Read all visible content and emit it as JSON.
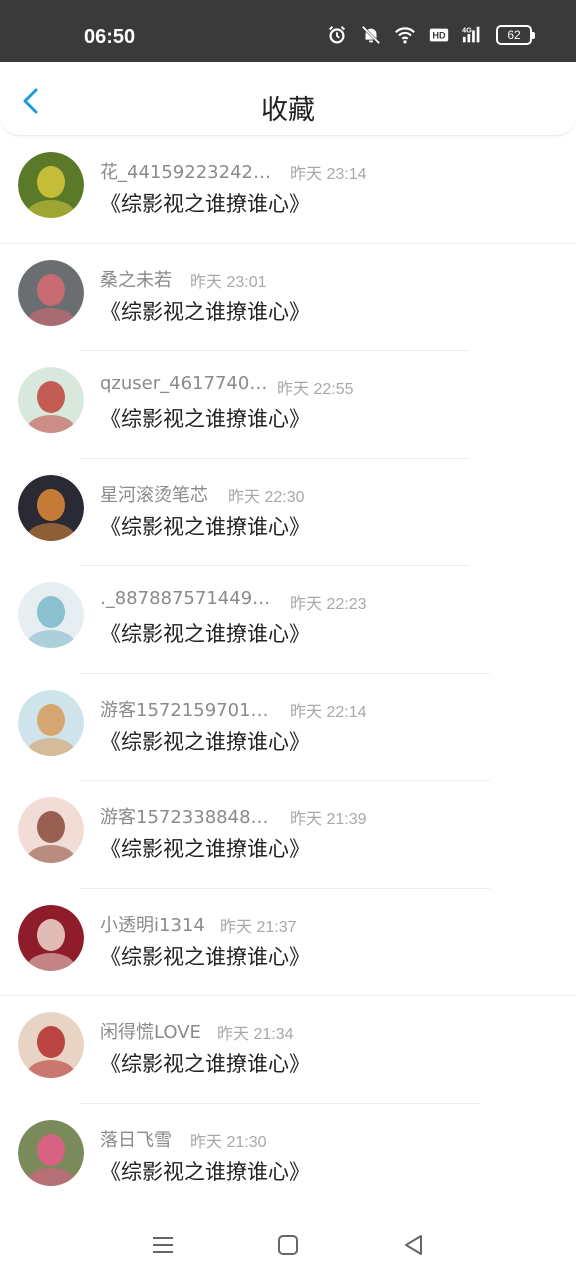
{
  "status": {
    "time": "06:50",
    "battery": "62",
    "icons": [
      "alarm-icon",
      "mute-icon",
      "wifi-icon",
      "hd-icon",
      "signal-4g-icon"
    ]
  },
  "header": {
    "title": "收藏",
    "back_icon": "chevron-left-icon"
  },
  "items": [
    {
      "name": "花_441592232424...",
      "time": "昨天 23:14",
      "content": "《综影视之谁撩谁心》",
      "avatar": {
        "bg": "#5a7a2a",
        "fg": "#d8c83a"
      }
    },
    {
      "name": "桑之未若",
      "time": "昨天 23:01",
      "content": "《综影视之谁撩谁心》",
      "avatar": {
        "bg": "#6b6e70",
        "fg": "#d86a72"
      }
    },
    {
      "name": "qzuser_461774091",
      "time": "昨天 22:55",
      "content": "《综影视之谁撩谁心》",
      "avatar": {
        "bg": "#d8e8dc",
        "fg": "#c0443c"
      }
    },
    {
      "name": "星河滚烫笔芯",
      "time": "昨天 22:30",
      "content": "《综影视之谁撩谁心》",
      "avatar": {
        "bg": "#2a2a34",
        "fg": "#e08a3a"
      }
    },
    {
      "name": "._8878875714490...",
      "time": "昨天 22:23",
      "content": "《综影视之谁撩谁心》",
      "avatar": {
        "bg": "#e6eef2",
        "fg": "#7ab8c8"
      }
    },
    {
      "name": "游客15721597018...",
      "time": "昨天 22:14",
      "content": "《综影视之谁撩谁心》",
      "avatar": {
        "bg": "#cfe4ea",
        "fg": "#d89a5a"
      }
    },
    {
      "name": "游客15723388486...",
      "time": "昨天 21:39",
      "content": "《综影视之谁撩谁心》",
      "avatar": {
        "bg": "#f2dcd6",
        "fg": "#8a4a3a"
      }
    },
    {
      "name": "小透明i1314",
      "time": "昨天 21:37",
      "content": "《综影视之谁撩谁心》",
      "avatar": {
        "bg": "#8e1c2a",
        "fg": "#f0d8d0"
      }
    },
    {
      "name": "闲得慌LOVE",
      "time": "昨天 21:34",
      "content": "《综影视之谁撩谁心》",
      "avatar": {
        "bg": "#e8d4c4",
        "fg": "#b02a2a"
      }
    },
    {
      "name": "落日飞雪",
      "time": "昨天 21:30",
      "content": "《综影视之谁撩谁心》",
      "avatar": {
        "bg": "#7a8a5a",
        "fg": "#e85a8a"
      }
    }
  ],
  "navbar": {
    "icons": [
      "menu-icon",
      "home-square-icon",
      "back-triangle-icon"
    ]
  },
  "colors": {
    "accent": "#1a9ae0",
    "status_bar": "#3a3a3a"
  }
}
